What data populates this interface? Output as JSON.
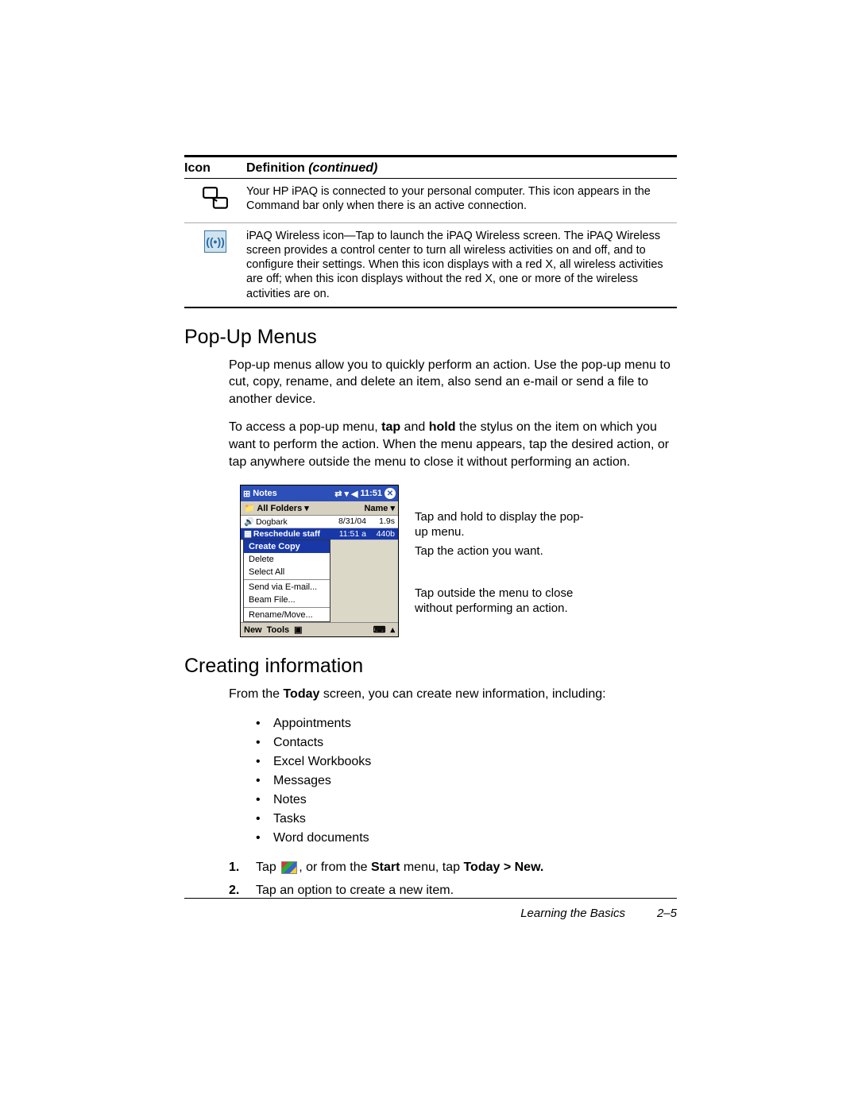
{
  "table": {
    "header_icon": "Icon",
    "header_def": "Definition",
    "header_cont": "(continued)",
    "row1_text": "Your HP iPAQ is connected to your personal computer. This icon appears in the Command bar only when there is an active connection.",
    "row2_text": "iPAQ Wireless icon—Tap to launch the iPAQ Wireless screen. The iPAQ Wireless screen provides a control center to turn all wireless activities on and off, and to configure their settings. When this icon displays with a red X, all wireless activities are off; when this icon displays without the red X, one or more of the wireless activities are on."
  },
  "popup": {
    "heading": "Pop-Up Menus",
    "para1": "Pop-up menus allow you to quickly perform an action. Use the pop-up menu to cut, copy, rename, and delete an item, also send an e-mail or send a file to another device.",
    "para2_a": "To access a pop-up menu, ",
    "para2_tap": "tap",
    "para2_b": " and ",
    "para2_hold": "hold",
    "para2_c": " the stylus on the item on which you want to perform the action. When the menu appears, tap the desired action, or tap anywhere outside the menu to close it without performing an action."
  },
  "pda": {
    "title": "Notes",
    "time": "11:51",
    "allfolders": "All Folders",
    "namecol": "Name",
    "row1_name": "Dogbark",
    "row1_date": "8/31/04",
    "row1_size": "1.9s",
    "row2_name": "Reschedule staff",
    "row2_date": "11:51 a",
    "row2_size": "440b",
    "menu": {
      "create": "Create Copy",
      "delete": "Delete",
      "selectall": "Select All",
      "sendemail": "Send via E-mail...",
      "beam": "Beam File...",
      "rename": "Rename/Move..."
    },
    "bottom_new": "New",
    "bottom_tools": "Tools"
  },
  "callouts": {
    "c1": "Tap and hold to display the pop-up menu.",
    "c2": "Tap the action you want.",
    "c3": "Tap outside the menu to close without performing an action."
  },
  "creating": {
    "heading": "Creating information",
    "para_a": "From the ",
    "para_today": "Today",
    "para_b": " screen, you can create new information, including:",
    "items": [
      "Appointments",
      "Contacts",
      "Excel Workbooks",
      "Messages",
      "Notes",
      "Tasks",
      "Word documents"
    ],
    "step1_a": "Tap ",
    "step1_b": ", or from the ",
    "step1_start": "Start",
    "step1_c": " menu, tap ",
    "step1_today": "Today > New.",
    "step2": "Tap an option to create a new item."
  },
  "footer": {
    "section": "Learning the Basics",
    "page": "2–5"
  }
}
